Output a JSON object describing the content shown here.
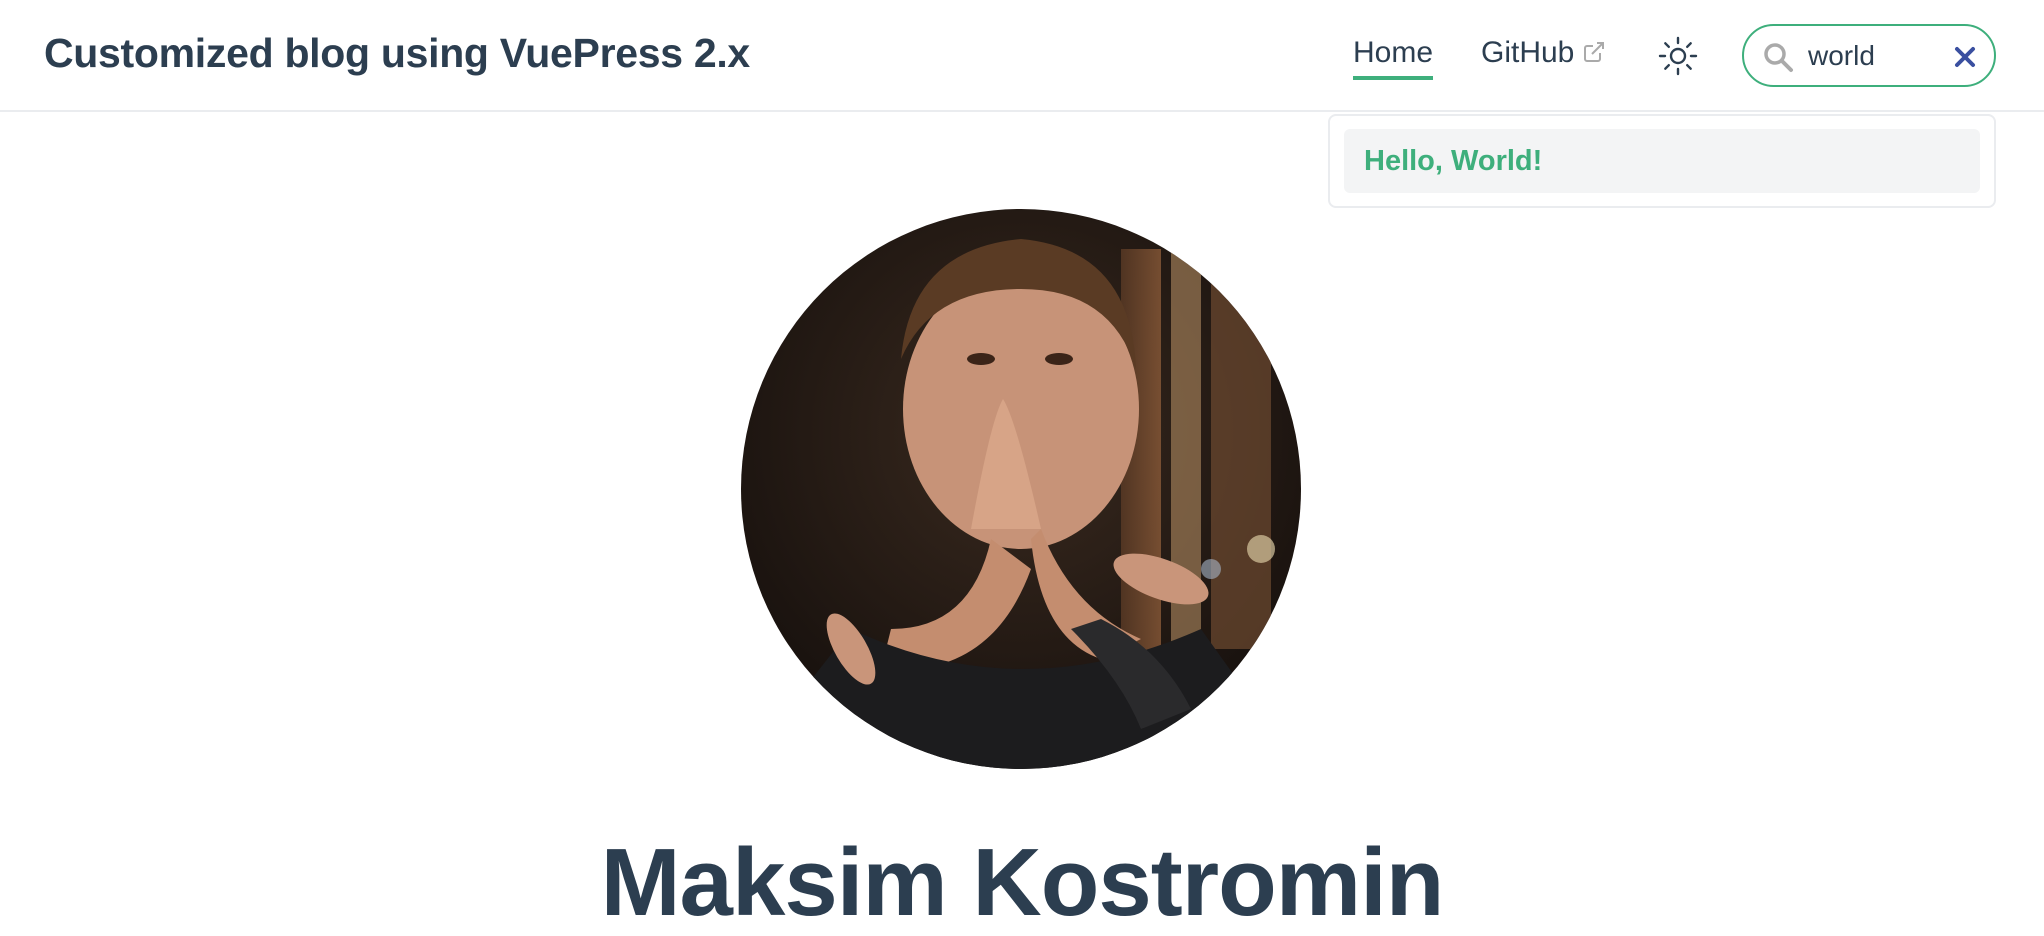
{
  "navbar": {
    "site_title": "Customized blog using VuePress 2.x",
    "links": [
      {
        "label": "Home",
        "active": true
      },
      {
        "label": "GitHub",
        "external": true
      }
    ],
    "theme_toggle_icon": "sun-icon"
  },
  "search": {
    "value": "world",
    "placeholder": "",
    "icons": {
      "search": "search-icon",
      "clear": "close-icon"
    },
    "suggestions": [
      {
        "title": "Hello, World!"
      }
    ]
  },
  "hero": {
    "avatar_alt": "avatar",
    "name": "Maksim Kostromin"
  },
  "colors": {
    "accent": "#3eaf7c",
    "text": "#2c3e50",
    "border": "#eaecef",
    "suggestion_bg": "#f3f4f5"
  }
}
